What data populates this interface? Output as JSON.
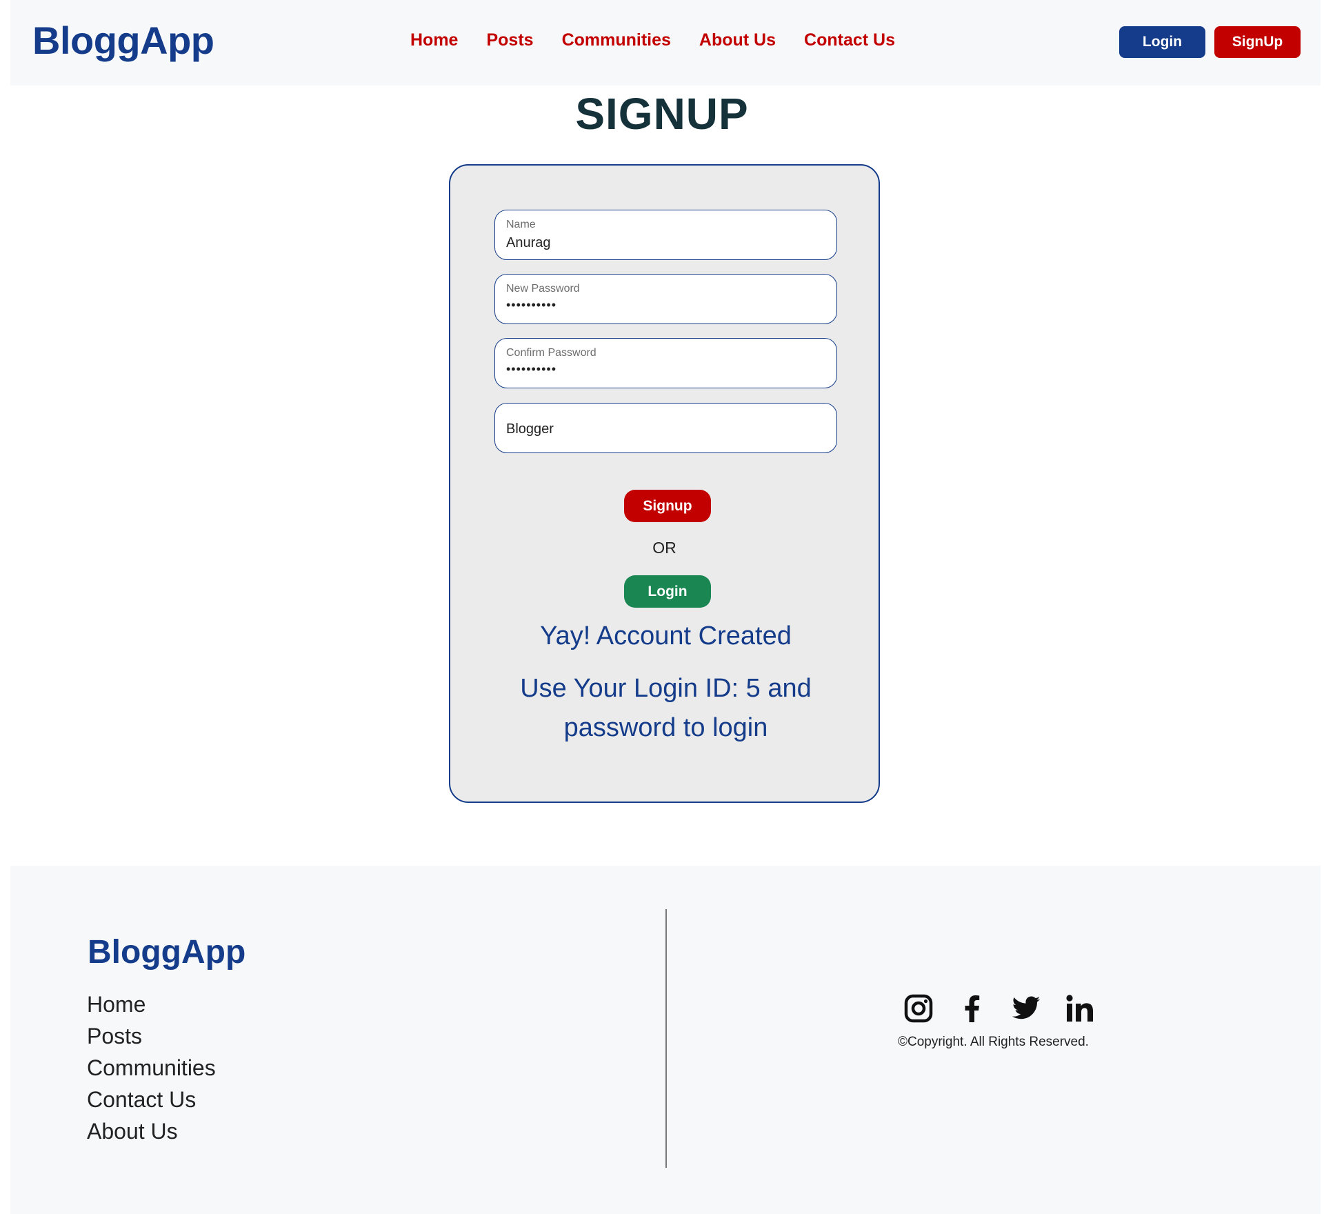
{
  "header": {
    "brand": "BloggApp",
    "nav": [
      "Home",
      "Posts",
      "Communities",
      "About Us",
      "Contact Us"
    ],
    "login_label": "Login",
    "signup_label": "SignUp"
  },
  "page_title": "SIGNUP",
  "form": {
    "name_label": "Name",
    "name_value": "Anurag",
    "new_password_label": "New Password",
    "new_password_value": "••••••••••",
    "confirm_password_label": "Confirm Password",
    "confirm_password_value": "••••••••••",
    "role_value": "Blogger",
    "signup_button": "Signup",
    "or_text": "OR",
    "login_button": "Login",
    "message_created": "Yay! Account Created",
    "message_login": "Use Your Login ID: 5 and password to login"
  },
  "footer": {
    "brand": "BloggApp",
    "links": [
      "Home",
      "Posts",
      "Communities",
      "Contact Us",
      "About Us"
    ],
    "socials": [
      "instagram-icon",
      "facebook-icon",
      "twitter-icon",
      "linkedin-icon"
    ],
    "copyright": "©Copyright. All Rights Reserved."
  },
  "colors": {
    "brand_blue": "#143c8a",
    "brand_red": "#c20000",
    "login_green": "#1a8752",
    "card_bg": "#ebebeb",
    "header_bg": "#f7f8fa"
  }
}
